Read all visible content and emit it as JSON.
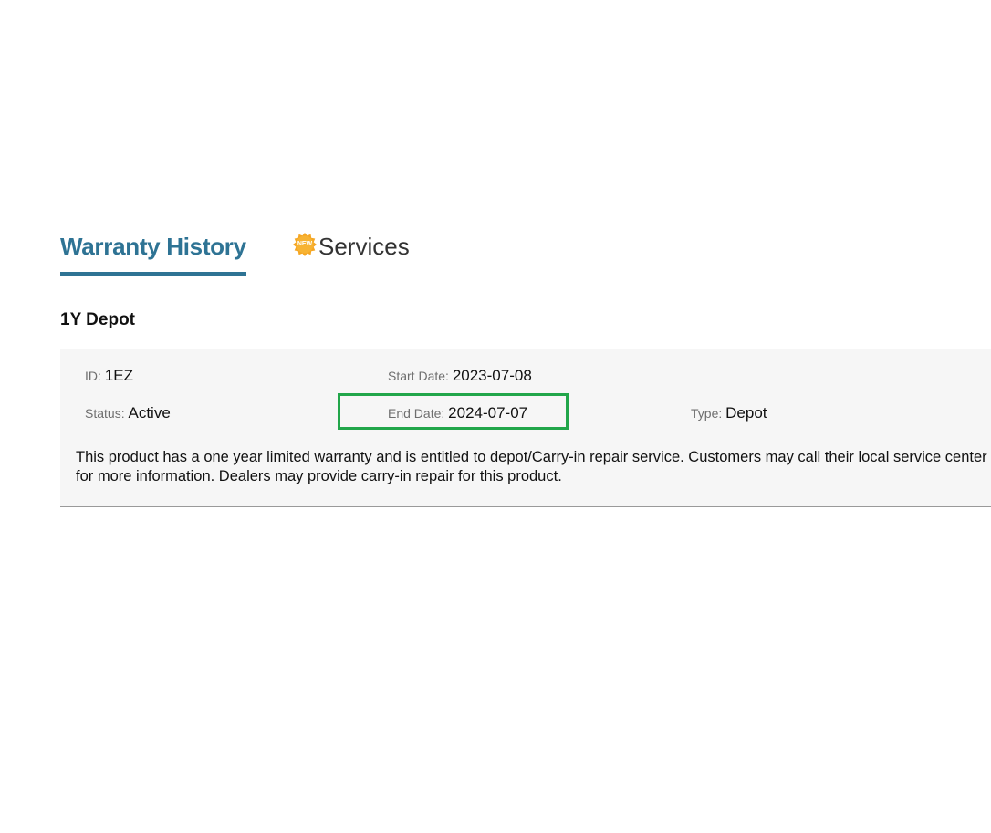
{
  "tabs": {
    "warranty_history": "Warranty History",
    "services": "Services",
    "new_badge": "NEW"
  },
  "warranty": {
    "title": "1Y Depot",
    "id_label": "ID",
    "id_value": "1EZ",
    "start_label": "Start Date",
    "start_value": "2023-07-08",
    "status_label": "Status",
    "status_value": "Active",
    "end_label": "End Date",
    "end_value": "2024-07-07",
    "type_label": "Type",
    "type_value": "Depot",
    "description": "This product has a one year limited warranty and is entitled to depot/Carry-in repair service. Customers may call their local service center for more information. Dealers may provide carry-in repair for this product."
  },
  "colors": {
    "accent": "#2e7394",
    "highlight": "#22a64a",
    "badge": "#f5a623"
  }
}
